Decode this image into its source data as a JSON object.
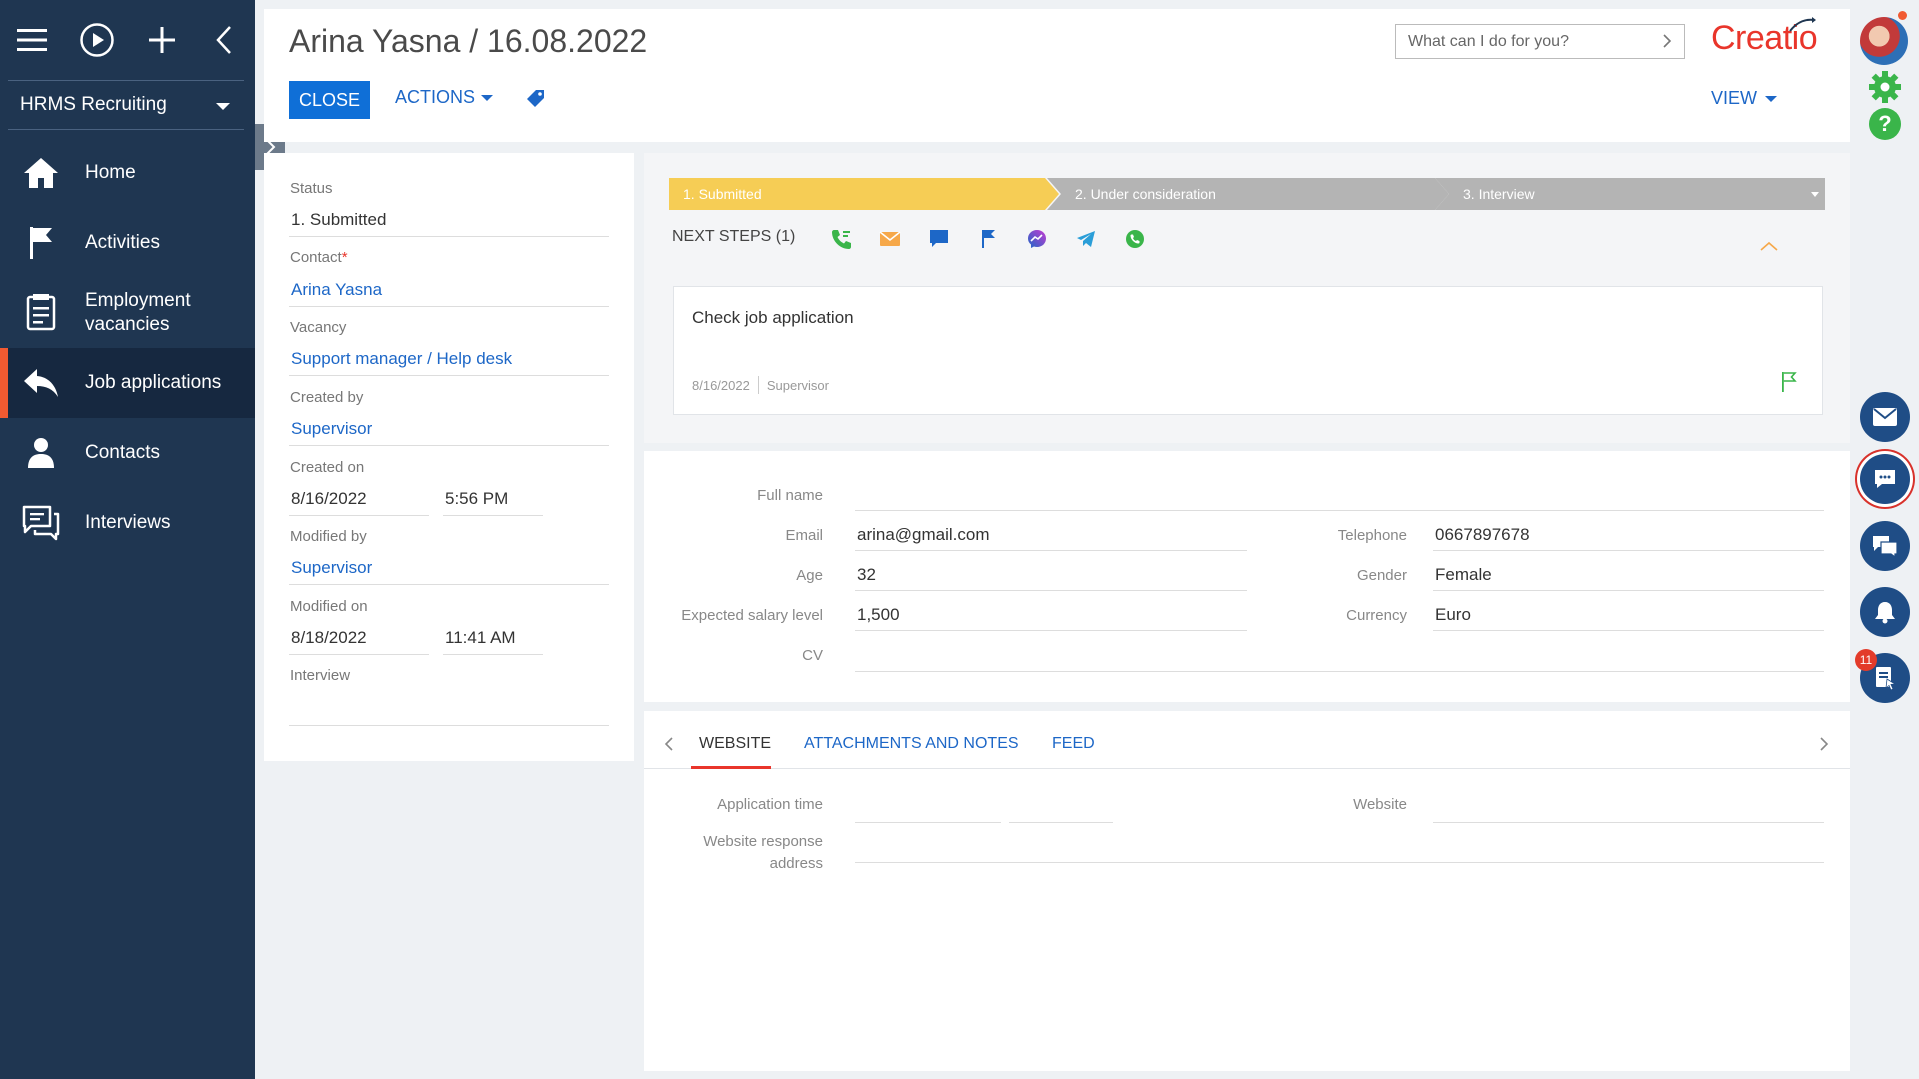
{
  "sidebar": {
    "workspace": "HRMS Recruiting",
    "items": [
      {
        "label": "Home",
        "icon": "home-icon"
      },
      {
        "label": "Activities",
        "icon": "flag-icon"
      },
      {
        "label": "Employment vacancies",
        "icon": "document-list-icon"
      },
      {
        "label": "Job applications",
        "icon": "reply-arrow-icon"
      },
      {
        "label": "Contacts",
        "icon": "person-icon"
      },
      {
        "label": "Interviews",
        "icon": "chat-bubbles-icon"
      }
    ],
    "active_index": 3
  },
  "header": {
    "title": "Arina Yasna / 16.08.2022",
    "close_label": "CLOSE",
    "actions_label": "ACTIONS",
    "view_label": "VIEW",
    "search_placeholder": "What can I do for you?",
    "logo_text": "Creatio"
  },
  "record": {
    "status_label": "Status",
    "status_value": "1. Submitted",
    "contact_label": "Contact",
    "contact_value": "Arina Yasna",
    "vacancy_label": "Vacancy",
    "vacancy_value": "Support manager / Help desk",
    "created_by_label": "Created by",
    "created_by_value": "Supervisor",
    "created_on_label": "Created on",
    "created_on_date": "8/16/2022",
    "created_on_time": "5:56 PM",
    "modified_by_label": "Modified by",
    "modified_by_value": "Supervisor",
    "modified_on_label": "Modified on",
    "modified_on_date": "8/18/2022",
    "modified_on_time": "11:41 AM",
    "interview_label": "Interview",
    "interview_value": ""
  },
  "dcm": {
    "stages": [
      "1. Submitted",
      "2. Under consideration",
      "3. Interview"
    ],
    "active_stage": 0,
    "next_steps_label": "NEXT STEPS (1)",
    "action_icons": [
      "phone-icon",
      "email-icon",
      "chat-icon",
      "flag-icon",
      "messenger-icon",
      "telegram-icon",
      "whatsapp-icon"
    ],
    "task": {
      "title": "Check job application",
      "date": "8/16/2022",
      "owner": "Supervisor"
    }
  },
  "profile": {
    "full_name_label": "Full name",
    "full_name_value": "",
    "email_label": "Email",
    "email_value": "arina@gmail.com",
    "telephone_label": "Telephone",
    "telephone_value": "0667897678",
    "age_label": "Age",
    "age_value": "32",
    "gender_label": "Gender",
    "gender_value": "Female",
    "salary_label": "Expected salary level",
    "salary_value": "1,500",
    "currency_label": "Currency",
    "currency_value": "Euro",
    "cv_label": "CV",
    "cv_value": ""
  },
  "tabs": {
    "items": [
      "WEBSITE",
      "ATTACHMENTS AND NOTES",
      "FEED"
    ],
    "active_index": 0,
    "website": {
      "application_time_label": "Application time",
      "website_label": "Website",
      "response_address_label": "Website response address"
    }
  },
  "rail": {
    "notification_count": "11"
  },
  "colors": {
    "sidebar_bg": "#1f3651",
    "accent_orange": "#f15a31",
    "primary_blue": "#0f6fd7",
    "stage_active": "#f6cd55",
    "stage_inactive": "#b4b4b4",
    "logo_red": "#e9352b"
  }
}
